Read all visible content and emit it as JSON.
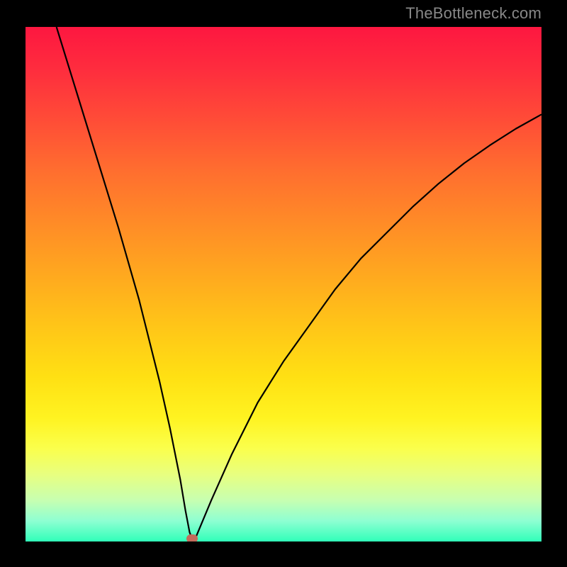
{
  "watermark": "TheBottleneck.com",
  "chart_data": {
    "type": "line",
    "title": "",
    "xlabel": "",
    "ylabel": "",
    "xlim": [
      0,
      100
    ],
    "ylim": [
      0,
      100
    ],
    "grid": false,
    "legend": false,
    "background_gradient": {
      "top": "#fd1740",
      "bottom": "#30ffb9"
    },
    "series": [
      {
        "name": "curve",
        "x": [
          6,
          10,
          14,
          18,
          22,
          26,
          28,
          30,
          31,
          31.8,
          32.3,
          33,
          36,
          40,
          45,
          50,
          55,
          60,
          65,
          70,
          75,
          80,
          85,
          90,
          95,
          100
        ],
        "y": [
          100,
          87,
          74,
          61,
          47,
          31,
          22,
          12,
          6,
          1.8,
          0.5,
          0.8,
          8,
          17,
          27,
          35,
          42,
          49,
          55,
          60,
          65,
          69.5,
          73.5,
          77,
          80.2,
          83
        ]
      }
    ],
    "marker": {
      "x": 32.3,
      "y": 0.5,
      "color": "#c36b5b"
    },
    "frame_color": "#000000"
  }
}
